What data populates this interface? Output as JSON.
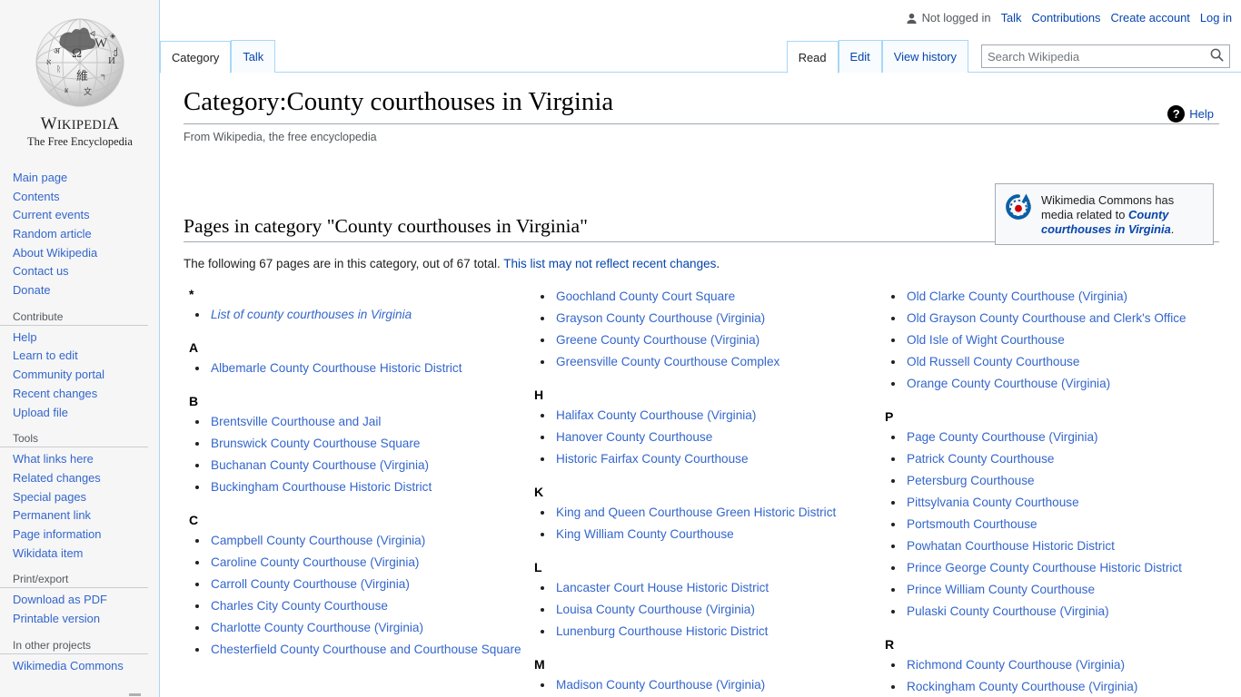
{
  "personal_bar": {
    "user_icon": "person-icon",
    "not_logged_in": "Not logged in",
    "links": [
      "Talk",
      "Contributions",
      "Create account",
      "Log in"
    ]
  },
  "branding": {
    "wordmark_1": "W",
    "wordmark_2": "IKIPEDI",
    "wordmark_3": "A",
    "tagline": "The Free Encyclopedia"
  },
  "sidebar": {
    "groups": [
      {
        "heading": "",
        "items": [
          "Main page",
          "Contents",
          "Current events",
          "Random article",
          "About Wikipedia",
          "Contact us",
          "Donate"
        ]
      },
      {
        "heading": "Contribute",
        "items": [
          "Help",
          "Learn to edit",
          "Community portal",
          "Recent changes",
          "Upload file"
        ]
      },
      {
        "heading": "Tools",
        "items": [
          "What links here",
          "Related changes",
          "Special pages",
          "Permanent link",
          "Page information",
          "Wikidata item"
        ]
      },
      {
        "heading": "Print/export",
        "items": [
          "Download as PDF",
          "Printable version"
        ]
      },
      {
        "heading": "In other projects",
        "items": [
          "Wikimedia Commons"
        ]
      }
    ]
  },
  "namespace_tabs": [
    {
      "label": "Category",
      "selected": true
    },
    {
      "label": "Talk",
      "selected": false
    }
  ],
  "view_tabs": [
    {
      "label": "Read",
      "selected": true
    },
    {
      "label": "Edit",
      "selected": false
    },
    {
      "label": "View history",
      "selected": false
    }
  ],
  "search": {
    "placeholder": "Search Wikipedia",
    "value": "",
    "icon": "search-icon"
  },
  "page": {
    "title": "Category:County courthouses in Virginia",
    "site_sub": "From Wikipedia, the free encyclopedia",
    "help_label": "Help",
    "help_icon_glyph": "?"
  },
  "commons_box": {
    "text_before": "Wikimedia Commons has media related to ",
    "link_text": "County courthouses in Virginia",
    "text_after": ".",
    "icon": "wikimedia-commons-logo"
  },
  "category_section": {
    "heading": "Pages in category \"County courthouses in Virginia\"",
    "intro_before": "The following 67 pages are in this category, out of 67 total. ",
    "intro_link": "This list may not reflect recent changes",
    "intro_after": ".",
    "total_pages": 67,
    "columns": [
      {
        "groups": [
          {
            "letter": "*",
            "items": [
              {
                "label": "List of county courthouses in Virginia",
                "italic": true
              }
            ]
          },
          {
            "letter": "A",
            "items": [
              {
                "label": "Albemarle County Courthouse Historic District",
                "italic": false
              }
            ]
          },
          {
            "letter": "B",
            "items": [
              {
                "label": "Brentsville Courthouse and Jail",
                "italic": false
              },
              {
                "label": "Brunswick County Courthouse Square",
                "italic": false
              },
              {
                "label": "Buchanan County Courthouse (Virginia)",
                "italic": false
              },
              {
                "label": "Buckingham Courthouse Historic District",
                "italic": false
              }
            ]
          },
          {
            "letter": "C",
            "items": [
              {
                "label": "Campbell County Courthouse (Virginia)",
                "italic": false
              },
              {
                "label": "Caroline County Courthouse (Virginia)",
                "italic": false
              },
              {
                "label": "Carroll County Courthouse (Virginia)",
                "italic": false
              },
              {
                "label": "Charles City County Courthouse",
                "italic": false
              },
              {
                "label": "Charlotte County Courthouse (Virginia)",
                "italic": false
              },
              {
                "label": "Chesterfield County Courthouse and Courthouse Square",
                "italic": false
              }
            ]
          }
        ]
      },
      {
        "groups": [
          {
            "letter": "",
            "items": [
              {
                "label": "Goochland County Court Square",
                "italic": false
              },
              {
                "label": "Grayson County Courthouse (Virginia)",
                "italic": false
              },
              {
                "label": "Greene County Courthouse (Virginia)",
                "italic": false
              },
              {
                "label": "Greensville County Courthouse Complex",
                "italic": false
              }
            ]
          },
          {
            "letter": "H",
            "items": [
              {
                "label": "Halifax County Courthouse (Virginia)",
                "italic": false
              },
              {
                "label": "Hanover County Courthouse",
                "italic": false
              },
              {
                "label": "Historic Fairfax County Courthouse",
                "italic": false
              }
            ]
          },
          {
            "letter": "K",
            "items": [
              {
                "label": "King and Queen Courthouse Green Historic District",
                "italic": false
              },
              {
                "label": "King William County Courthouse",
                "italic": false
              }
            ]
          },
          {
            "letter": "L",
            "items": [
              {
                "label": "Lancaster Court House Historic District",
                "italic": false
              },
              {
                "label": "Louisa County Courthouse (Virginia)",
                "italic": false
              },
              {
                "label": "Lunenburg Courthouse Historic District",
                "italic": false
              }
            ]
          },
          {
            "letter": "M",
            "items": [
              {
                "label": "Madison County Courthouse (Virginia)",
                "italic": false
              }
            ]
          }
        ]
      },
      {
        "groups": [
          {
            "letter": "",
            "items": [
              {
                "label": "Old Clarke County Courthouse (Virginia)",
                "italic": false
              },
              {
                "label": "Old Grayson County Courthouse and Clerk's Office",
                "italic": false
              },
              {
                "label": "Old Isle of Wight Courthouse",
                "italic": false
              },
              {
                "label": "Old Russell County Courthouse",
                "italic": false
              },
              {
                "label": "Orange County Courthouse (Virginia)",
                "italic": false
              }
            ]
          },
          {
            "letter": "P",
            "items": [
              {
                "label": "Page County Courthouse (Virginia)",
                "italic": false
              },
              {
                "label": "Patrick County Courthouse",
                "italic": false
              },
              {
                "label": "Petersburg Courthouse",
                "italic": false
              },
              {
                "label": "Pittsylvania County Courthouse",
                "italic": false
              },
              {
                "label": "Portsmouth Courthouse",
                "italic": false
              },
              {
                "label": "Powhatan Courthouse Historic District",
                "italic": false
              },
              {
                "label": "Prince George County Courthouse Historic District",
                "italic": false
              },
              {
                "label": "Prince William County Courthouse",
                "italic": false
              },
              {
                "label": "Pulaski County Courthouse (Virginia)",
                "italic": false
              }
            ]
          },
          {
            "letter": "R",
            "items": [
              {
                "label": "Richmond County Courthouse (Virginia)",
                "italic": false
              },
              {
                "label": "Rockingham County Courthouse (Virginia)",
                "italic": false
              }
            ]
          }
        ]
      }
    ]
  },
  "colors": {
    "link": "#3366cc",
    "link_alt": "#0645ad",
    "sidebar_bg": "#f6f6f6",
    "tab_border": "#a7d7f9",
    "rule": "#a2a9b1"
  }
}
